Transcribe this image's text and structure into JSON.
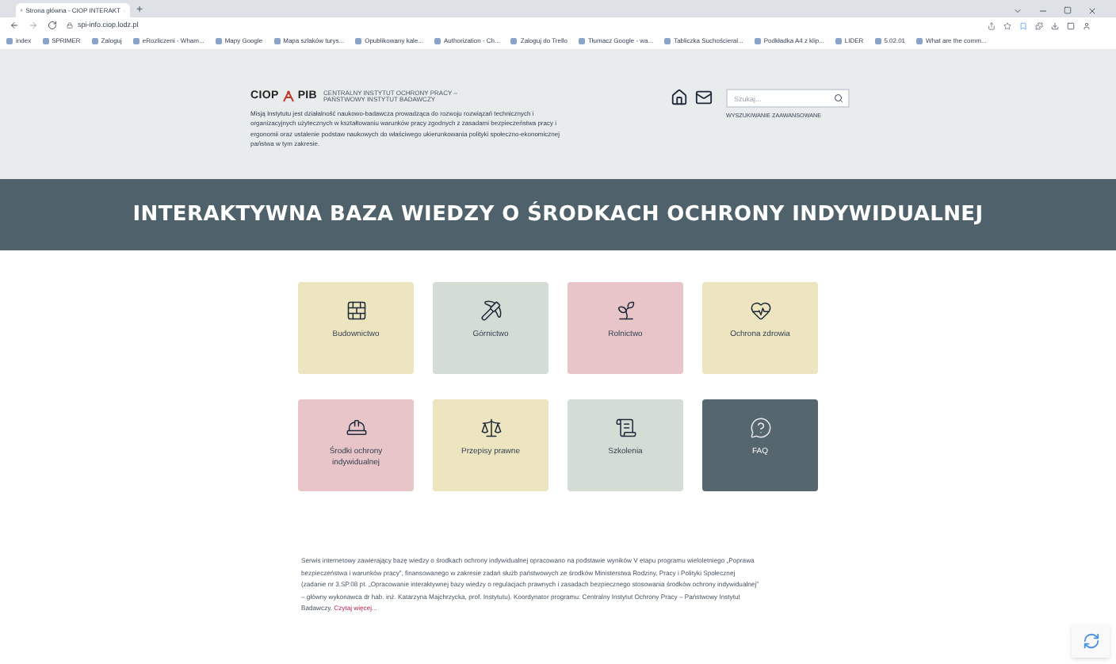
{
  "browser": {
    "tab_title": "Strona główna - CIOP INTERAKT",
    "new_tab": "+",
    "address": "spi-info.ciop.lodz.pl",
    "bookmarks": [
      "index",
      "SPRIMER",
      "Zaloguj",
      "eRozliczeni - Wham...",
      "Mapy Google",
      "Mapa szlaków turys...",
      "Opublikowany kale...",
      "Authorization - Ch...",
      "Zaloguj do Trello",
      "Tłumacz Google - wa...",
      "Tabliczka Suchościeral...",
      "Podkładka A4 z klip...",
      "LIDER",
      "5.02.01",
      "What are the comm..."
    ]
  },
  "header": {
    "logo_left": "CIOP",
    "logo_right": "PIB",
    "logo_tagline": "CENTRALNY INSTYTUT OCHRONY PRACY – PAŃSTWOWY INSTYTUT BADAWCZY",
    "mission": "Misją Instytutu jest działalność naukowo-badawcza prowadząca do rozwoju rozwiązań technicznych i organizacyjnych użytecznych w kształtowaniu warunków pracy zgodnych z zasadami bezpieczeństwa pracy i ergonomii oraz ustalenie podstaw naukowych do właściwego ukierunkowania polityki społeczno-ekonomicznej państwa w tym zakresie.",
    "search": {
      "placeholder": "Szukaj..."
    },
    "advanced_search": "WYSZUKIWANIE ZAAWANSOWANE"
  },
  "banner": "INTERAKTYWNA BAZA WIEDZY O ŚRODKACH OCHRONY INDYWIDUALNEJ",
  "tiles": [
    {
      "label": "Budownictwo",
      "color": "#ece5bf"
    },
    {
      "label": "Górnictwo",
      "color": "#d4ddd5"
    },
    {
      "label": "Rolnictwo",
      "color": "#e7c5c8"
    },
    {
      "label": "Ochrona zdrowia",
      "color": "#ece5bf"
    },
    {
      "label": "Środki ochrony indywidualnej",
      "color": "#e7c5c8"
    },
    {
      "label": "Przepisy prawne",
      "color": "#ece5bf"
    },
    {
      "label": "Szkolenia",
      "color": "#d4ddd5"
    },
    {
      "label": "FAQ",
      "color": "#56666f"
    }
  ],
  "footer": {
    "text": "Serwis internetowy zawierający bazę wiedzy o środkach ochrony indywidualnej opracowano na podstawie wyników V etapu programu wieloletniego „Poprawa bezpieczeństwa i warunków pracy”, finansowanego w zakresie zadań służb państwowych ze środków Ministerstwa Rodziny, Pracy i Polityki Społecznej (zadanie nr 3.SP.08 pt. „Opracowanie interaktywnej bazy wiedzy o regulacjach prawnych i zasadach bezpiecznego stosowania środków ochrony indywidualnej” – główny wykonawca dr hab. inż. Katarzyna Majchrzycka, prof. Instytutu). Koordynator programu: Centralny Instytut Ochrony Pracy – Państwowy Instytut Badawczy.",
    "link": "Czytaj więcej..."
  }
}
